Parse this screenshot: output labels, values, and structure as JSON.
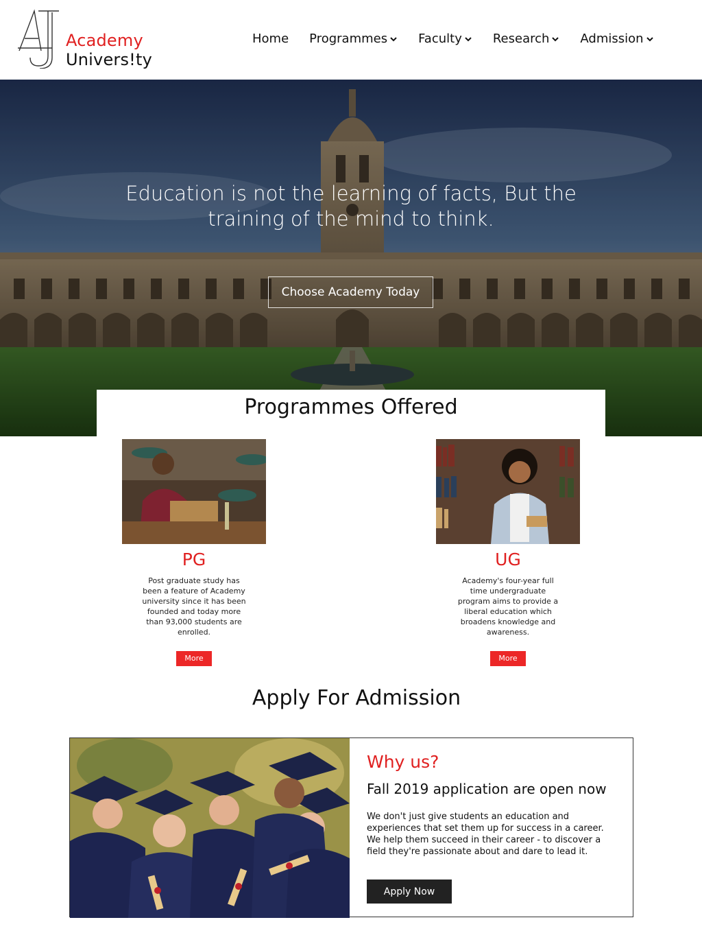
{
  "brand": {
    "line1": "Academy",
    "line2": "Univers!ty",
    "accent": "#e02020"
  },
  "nav": [
    {
      "label": "Home",
      "icon": ""
    },
    {
      "label": "Programmes",
      "icon": "chevron-down-icon"
    },
    {
      "label": "Faculty",
      "icon": "chevron-down-icon"
    },
    {
      "label": "Research",
      "icon": "chevron-down-icon"
    },
    {
      "label": "Admission",
      "icon": "chevron-down-icon"
    }
  ],
  "hero": {
    "line1": "Education is not the learning of facts, But the",
    "line2": "training of the mind to think.",
    "cta": "Choose Academy Today"
  },
  "programmes": {
    "title": "Programmes Offered",
    "items": [
      {
        "name": "PG",
        "desc": "Post graduate study has been a feature of Academy university since it has been founded and today more than 93,000 students are enrolled.",
        "more": "More"
      },
      {
        "name": "UG",
        "desc": "Academy's four-year full time undergraduate program aims to provide a liberal education which broadens knowledge and awareness.",
        "more": "More"
      }
    ]
  },
  "apply": {
    "title": "Apply For Admission",
    "why": "Why us?",
    "fall": "Fall 2019 application are open now",
    "desc": "We don't just give students an education and experiences that set them up for success in a career. We help them succeed in their career - to discover a field they're passionate about and dare to lead it.",
    "button": "Apply Now"
  }
}
